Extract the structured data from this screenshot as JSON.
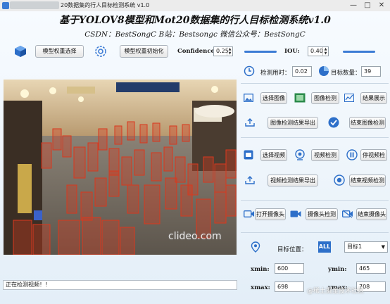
{
  "window": {
    "app_name": "基于YOLOV8",
    "title": "20数据集的行人目标检测系统 v1.0"
  },
  "header": {
    "title": "基于YOLOV8模型和Mot20数据集的行人目标检测系统v1.0",
    "subtitle": "CSDN：BestSongC  B站：Bestsongc  微信公众号：BestSongC"
  },
  "toolbar": {
    "select_weights": "模型权重选择",
    "init_weights": "模型权重初始化",
    "confidence_label": "Confidence:",
    "confidence_value": "0.25",
    "iou_label": "IOU:",
    "iou_value": "0.40"
  },
  "stats": {
    "time_label": "检测用时：",
    "time_value": "0.02",
    "count_label": "目标数量：",
    "count_value": "39"
  },
  "image_panel": {
    "select_image": "选择图像",
    "detect_image": "图像检测",
    "show_result": "结果展示",
    "export_image": "图像检测结果导出",
    "stop_image": "结束图像检测"
  },
  "video_panel": {
    "select_video": "选择视频",
    "detect_video": "视频检测",
    "pause_video": "停视频检",
    "export_video": "视频检测结果导出",
    "stop_video": "结束视频检测"
  },
  "camera_panel": {
    "open_camera": "打开摄像头",
    "camera_detect": "摄像头检测",
    "close_camera": "结束摄像头"
  },
  "target": {
    "position_label": "目标位置：",
    "select_value": "目标1",
    "xmin_label": "xmin:",
    "xmin_value": "600",
    "ymin_label": "ymin:",
    "ymin_value": "465",
    "xmax_label": "xmax:",
    "xmax_value": "698",
    "ymax_label": "ymax:",
    "ymax_value": "708"
  },
  "status": {
    "text": "正在检测视频！！"
  },
  "watermarks": {
    "clideo": "clideo.com",
    "community": "@稀土掘金技术社区"
  },
  "colors": {
    "accent": "#3b7bd4",
    "bbox": "#d9381e"
  }
}
